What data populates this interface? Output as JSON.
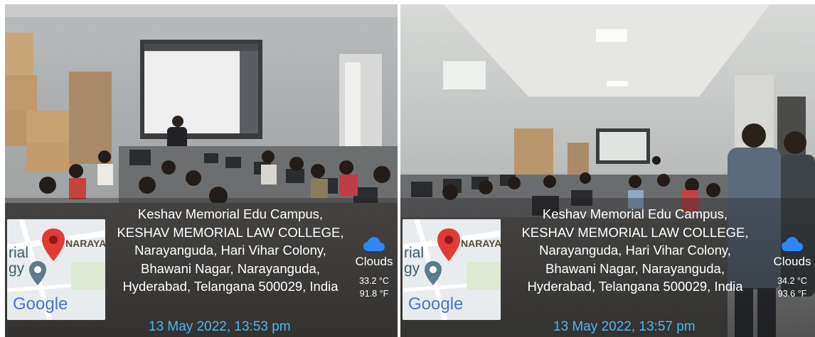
{
  "photos": [
    {
      "address_lines": [
        "Keshav Memorial Edu Campus,",
        "KESHAV MEMORIAL LAW COLLEGE,",
        "Narayanguda, Hari Vihar Colony,",
        "Bhawani Nagar, Narayanguda,",
        "Hyderabad, Telangana 500029, India"
      ],
      "date": "13 May 2022, 13:53 pm",
      "weather": {
        "icon": "cloud-icon",
        "condition": "Clouds",
        "temp_c": "33.2 °C",
        "temp_f": "91.8 °F"
      },
      "map": {
        "logo": "Google",
        "label_top": "NARAYA",
        "label_left_1": "rial",
        "label_left_2": "gy"
      }
    },
    {
      "address_lines": [
        "Keshav Memorial Edu Campus,",
        "KESHAV MEMORIAL LAW COLLEGE,",
        "Narayanguda, Hari Vihar Colony,",
        "Bhawani Nagar, Narayanguda,",
        "Hyderabad, Telangana 500029, India"
      ],
      "date": "13 May 2022, 13:57 pm",
      "weather": {
        "icon": "cloud-icon",
        "condition": "Clouds",
        "temp_c": "34.2 °C",
        "temp_f": "93.6 °F"
      },
      "map": {
        "logo": "Google",
        "label_top": "NARAYA",
        "label_left_1": "rial",
        "label_left_2": "gy"
      }
    }
  ],
  "colors": {
    "date_text": "#4fb4f0",
    "pin_red": "#e53935",
    "cloud_blue": "#2f86f6"
  }
}
